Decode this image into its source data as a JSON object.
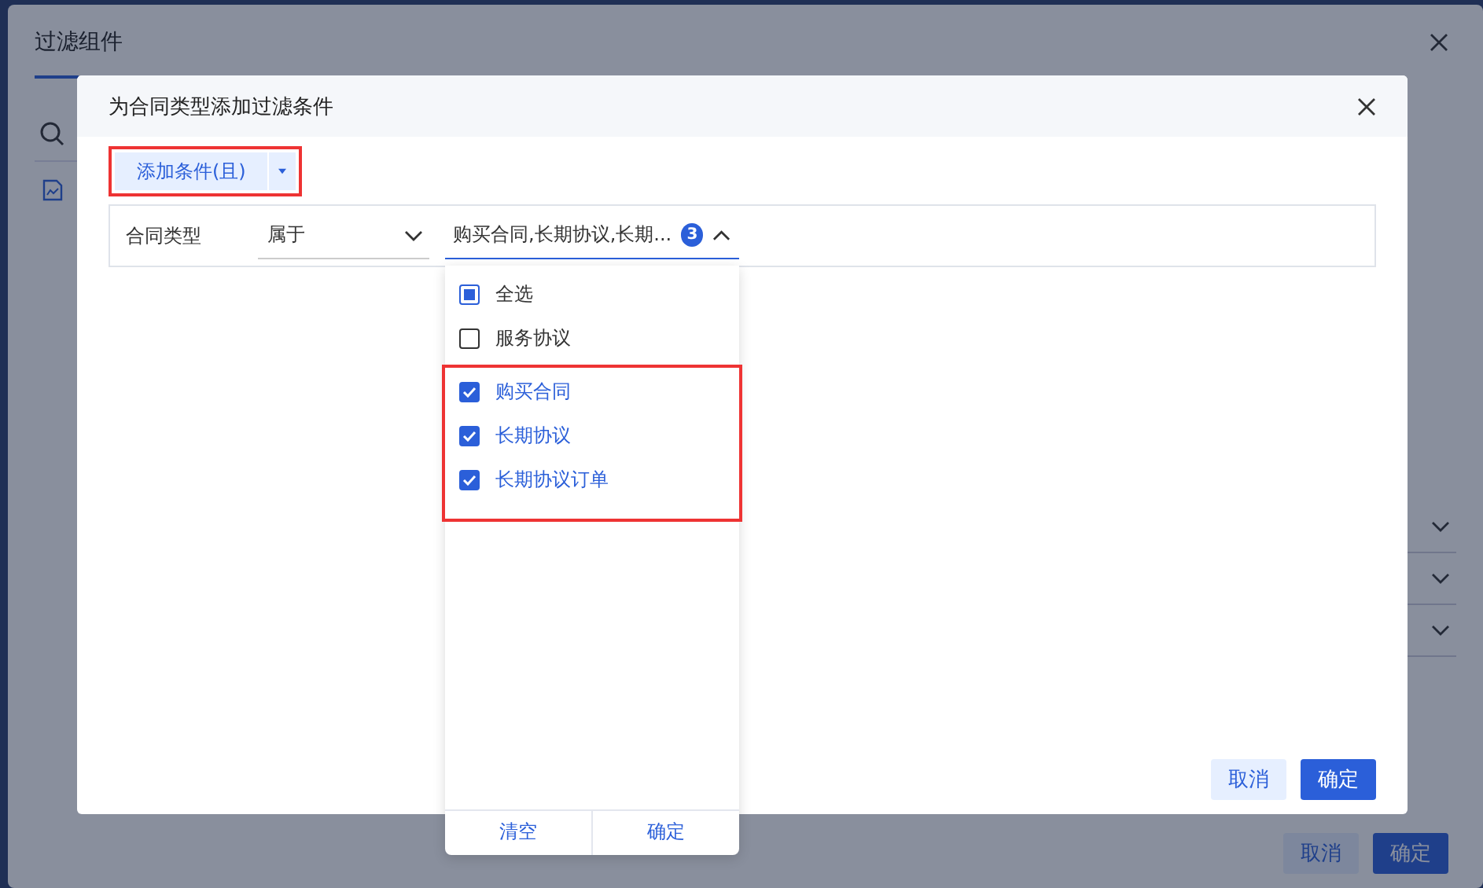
{
  "background_dialog": {
    "title": "过滤组件",
    "footer_buttons": [
      {
        "label": "取消",
        "kind": "secondary"
      },
      {
        "label": "确定",
        "kind": "primary"
      }
    ]
  },
  "dialog": {
    "title": "为合同类型添加过滤条件",
    "add_condition": {
      "label": "添加条件(且)",
      "highlighted": true
    },
    "condition": {
      "field": "合同类型",
      "operator": "属于",
      "value": "购买合同,长期协议,长期...",
      "count": "3",
      "expanded": true
    },
    "dropdown": {
      "select_all": {
        "label": "全选",
        "indeterminate": true
      },
      "options": [
        {
          "label": "服务协议",
          "checked": false,
          "highlighted": false
        },
        {
          "label": "购买合同",
          "checked": true,
          "highlighted": true
        },
        {
          "label": "长期协议",
          "checked": true,
          "highlighted": true
        },
        {
          "label": "长期协议订单",
          "checked": true,
          "highlighted": true
        }
      ],
      "footer_buttons": [
        "清空",
        "确定"
      ]
    },
    "footer_buttons": [
      {
        "label": "取消",
        "kind": "secondary"
      },
      {
        "label": "确定",
        "kind": "primary"
      }
    ]
  }
}
